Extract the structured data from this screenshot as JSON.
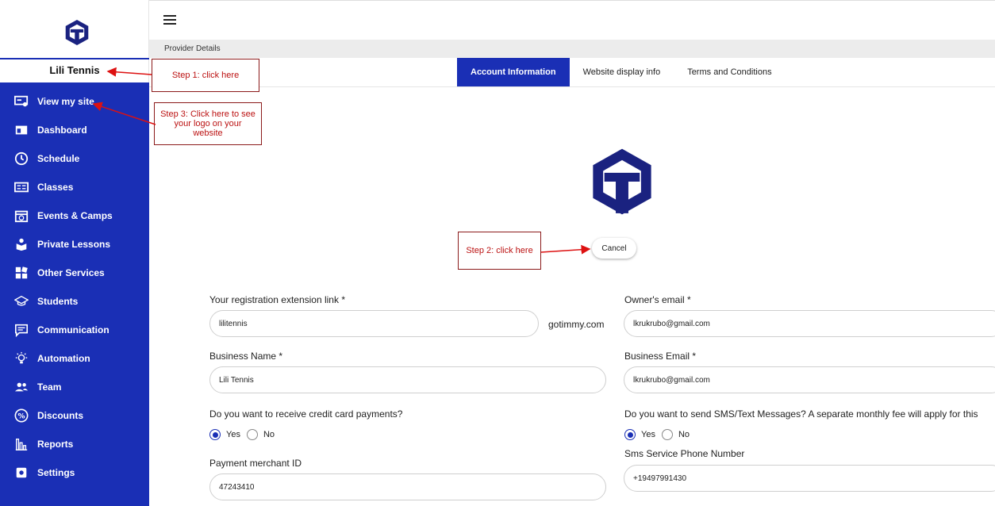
{
  "sidebar": {
    "provider_name": "Lili Tennis",
    "items": [
      {
        "label": "View my site",
        "icon": "monitor-icon"
      },
      {
        "label": "Dashboard",
        "icon": "dashboard-icon"
      },
      {
        "label": "Schedule",
        "icon": "clock-icon"
      },
      {
        "label": "Classes",
        "icon": "classes-icon"
      },
      {
        "label": "Events & Camps",
        "icon": "calendar-icon"
      },
      {
        "label": "Private Lessons",
        "icon": "private-lessons-icon"
      },
      {
        "label": "Other Services",
        "icon": "services-grid-icon"
      },
      {
        "label": "Students",
        "icon": "graduation-cap-icon"
      },
      {
        "label": "Communication",
        "icon": "chat-icon"
      },
      {
        "label": "Automation",
        "icon": "lightbulb-icon"
      },
      {
        "label": "Team",
        "icon": "team-icon"
      },
      {
        "label": "Discounts",
        "icon": "percent-icon"
      },
      {
        "label": "Reports",
        "icon": "reports-icon"
      },
      {
        "label": "Settings",
        "icon": "settings-icon"
      }
    ]
  },
  "header": {
    "breadcrumb": "Provider Details"
  },
  "tabs": [
    {
      "label": "Account Information",
      "active": true
    },
    {
      "label": "Website display info",
      "active": false
    },
    {
      "label": "Terms and Conditions",
      "active": false
    }
  ],
  "logo": {
    "cancel_label": "Cancel"
  },
  "form": {
    "registration_link": {
      "label": "Your registration extension link *",
      "value": "lilitennis",
      "suffix": "gotimmy.com"
    },
    "owner_email": {
      "label": "Owner's email *",
      "value": "lkrukrubo@gmail.com"
    },
    "business_name": {
      "label": "Business Name *",
      "value": "Lili Tennis"
    },
    "business_email": {
      "label": "Business Email *",
      "value": "lkrukrubo@gmail.com"
    },
    "credit_card": {
      "label": "Do you want to receive credit card payments?",
      "yes": "Yes",
      "no": "No",
      "selected": "Yes"
    },
    "sms": {
      "label": "Do you want to send SMS/Text Messages? A separate monthly fee will apply for this",
      "yes": "Yes",
      "no": "No",
      "selected": "Yes"
    },
    "merchant_id": {
      "label": "Payment merchant ID",
      "value": "47243410"
    },
    "sms_phone": {
      "label": "Sms Service Phone Number",
      "value": "+19497991430"
    }
  },
  "annotations": {
    "step1": "Step 1: click here",
    "step2": "Step 2: click here",
    "step3": "Step 3: Click here to see your logo on your website"
  },
  "colors": {
    "brand": "#1a2fb5",
    "annotation": "#b11111"
  }
}
